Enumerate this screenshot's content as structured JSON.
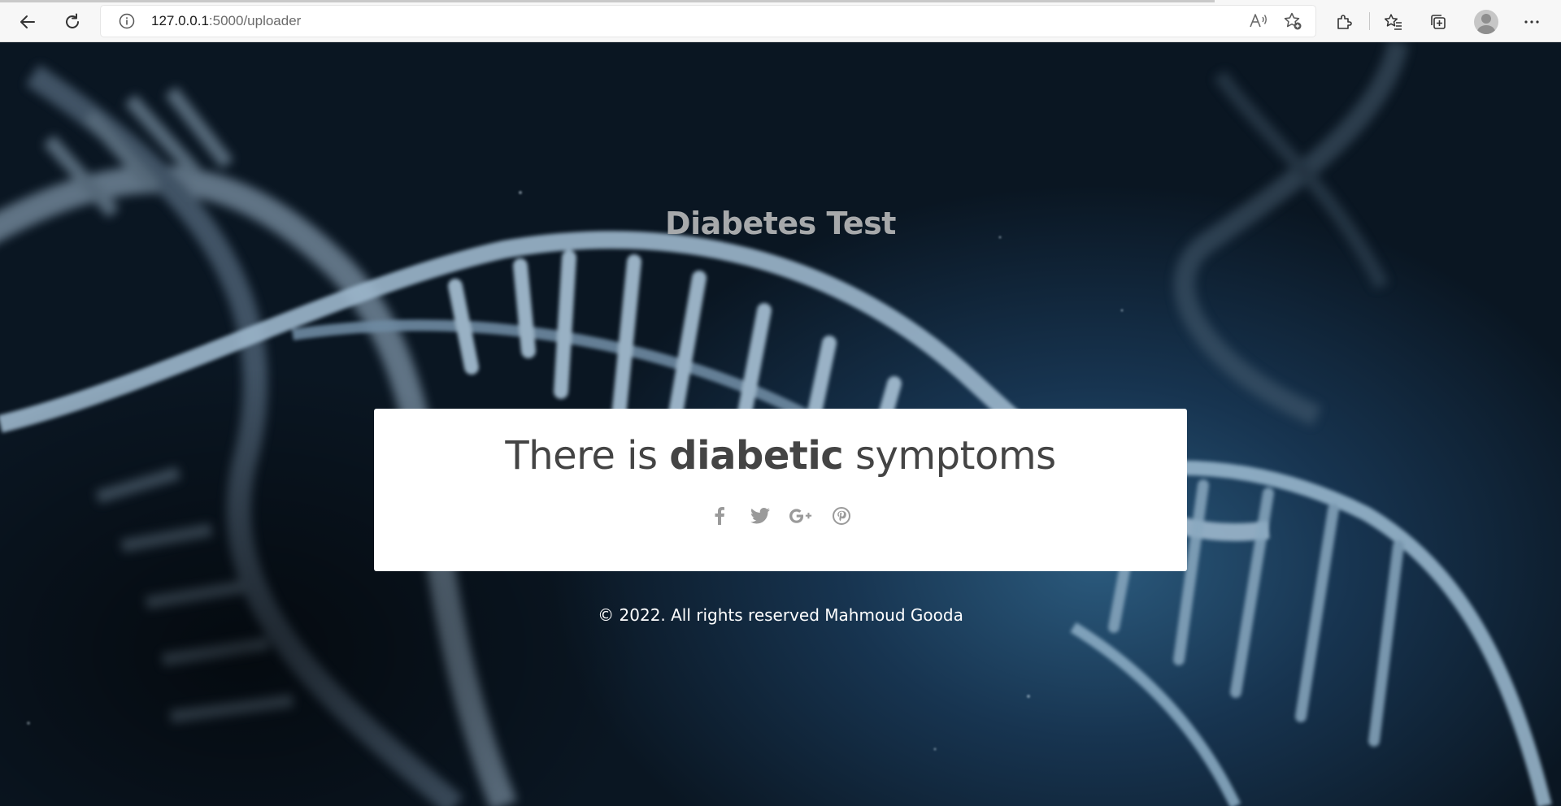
{
  "browser": {
    "url_host": "127.0.0.1",
    "url_rest": ":5000/uploader",
    "icons": [
      "back-arrow-icon",
      "refresh-icon",
      "info-icon",
      "read-aloud-icon",
      "add-favorite-icon",
      "extensions-icon",
      "favorites-icon",
      "collections-icon",
      "profile-icon",
      "more-icon"
    ]
  },
  "page": {
    "title": "Diabetes Test",
    "result": {
      "prefix": "There is",
      "emphasis": "diabetic",
      "suffix": "symptoms"
    },
    "social": [
      "facebook-icon",
      "twitter-icon",
      "google-plus-icon",
      "pinterest-icon"
    ],
    "footer": "© 2022. All rights reserved Mahmoud Gooda"
  },
  "colors": {
    "title": "#a7a9ab",
    "result_text": "#444444",
    "social_icon": "#9a9a9a",
    "footer_text": "#ffffff",
    "card_bg": "#ffffff"
  }
}
